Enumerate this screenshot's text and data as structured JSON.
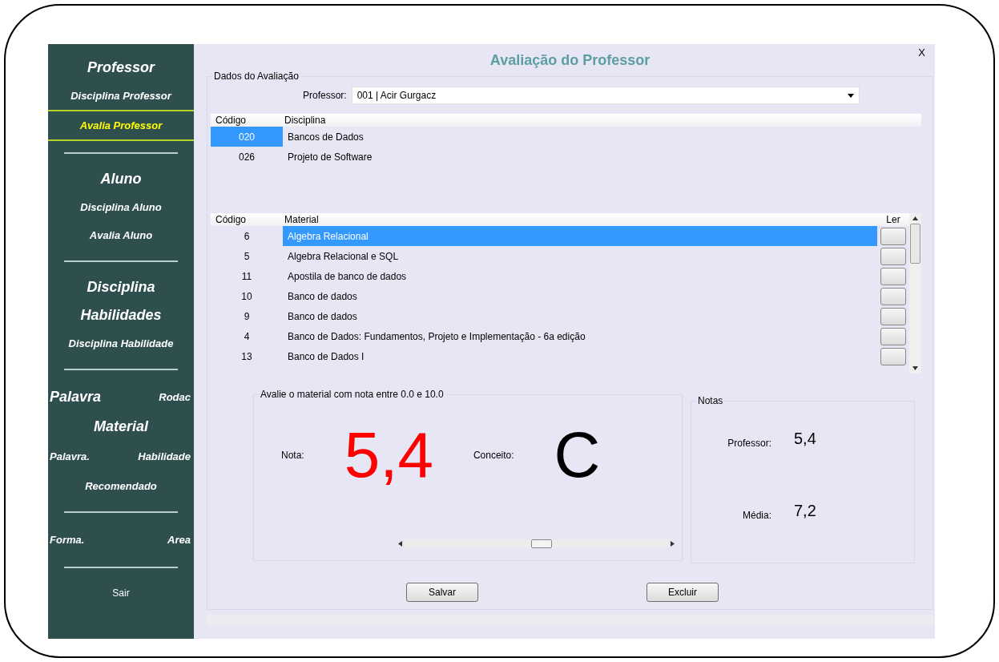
{
  "sidebar": {
    "items": [
      {
        "kind": "heading",
        "label": "Professor",
        "selected": false
      },
      {
        "kind": "item",
        "label": "Disciplina Professor",
        "selected": false
      },
      {
        "kind": "item",
        "label": "Avalia Professor",
        "selected": true
      },
      {
        "kind": "separator"
      },
      {
        "kind": "heading",
        "label": "Aluno",
        "selected": false
      },
      {
        "kind": "item",
        "label": "Disciplina Aluno",
        "selected": false
      },
      {
        "kind": "item",
        "label": "Avalia Aluno",
        "selected": false
      },
      {
        "kind": "separator"
      },
      {
        "kind": "heading",
        "label": "Disciplina",
        "selected": false
      },
      {
        "kind": "heading",
        "label": "Habilidades",
        "selected": false
      },
      {
        "kind": "item",
        "label": "Disciplina Habilidade",
        "selected": false
      },
      {
        "kind": "separator"
      },
      {
        "kind": "pair",
        "items": [
          {
            "kind": "heading",
            "label": "Palavra",
            "selected": false
          },
          {
            "kind": "item",
            "label": "Rodac",
            "selected": false
          }
        ]
      },
      {
        "kind": "heading",
        "label": "Material",
        "selected": false
      },
      {
        "kind": "pair",
        "items": [
          {
            "kind": "item",
            "label": "Palavra.",
            "selected": false
          },
          {
            "kind": "item",
            "label": "Habilidade",
            "selected": false
          }
        ]
      },
      {
        "kind": "item",
        "label": "Recomendado",
        "selected": false
      },
      {
        "kind": "separator"
      },
      {
        "kind": "pair",
        "items": [
          {
            "kind": "item",
            "label": "Forma.",
            "selected": false
          },
          {
            "kind": "item",
            "label": "Area",
            "selected": false
          }
        ]
      },
      {
        "kind": "separator"
      },
      {
        "kind": "plain",
        "label": "Sair",
        "selected": false
      }
    ]
  },
  "window": {
    "title": "Avaliação do Professor",
    "close": "X"
  },
  "group": {
    "title": "Dados do Avaliação",
    "professor_label": "Professor:",
    "professor_value": "001 | Acir Gurgacz"
  },
  "disciplinas": {
    "columns": [
      "Código",
      "Disciplina"
    ],
    "rows": [
      {
        "code": "020",
        "name": "Bancos de Dados",
        "selected": true
      },
      {
        "code": "026",
        "name": "Projeto de Software",
        "selected": false
      }
    ]
  },
  "materiais": {
    "columns": [
      "Código",
      "Material",
      "Ler"
    ],
    "rows": [
      {
        "code": "6",
        "name": "Algebra Relacional",
        "selected": true
      },
      {
        "code": "5",
        "name": "Algebra Relacional e SQL",
        "selected": false
      },
      {
        "code": "11",
        "name": "Apostila de banco de dados",
        "selected": false
      },
      {
        "code": "10",
        "name": "Banco de dados",
        "selected": false
      },
      {
        "code": "9",
        "name": "Banco de dados",
        "selected": false
      },
      {
        "code": "4",
        "name": "Banco de Dados: Fundamentos, Projeto e Implementação - 6a edição",
        "selected": false
      },
      {
        "code": "13",
        "name": "Banco de Dados I",
        "selected": false
      }
    ]
  },
  "rating": {
    "title": "Avalie o material com nota entre 0.0 e 10.0",
    "nota_label": "Nota:",
    "nota": "5,4",
    "conceito_label": "Conceito:",
    "conceito": "C",
    "level": 0.53
  },
  "notas": {
    "title": "Notas",
    "items": [
      {
        "label": "Professor:",
        "value": "5,4"
      },
      {
        "label": "Média:",
        "value": "7,2"
      }
    ]
  },
  "buttons": [
    "Salvar",
    "Excluir"
  ]
}
